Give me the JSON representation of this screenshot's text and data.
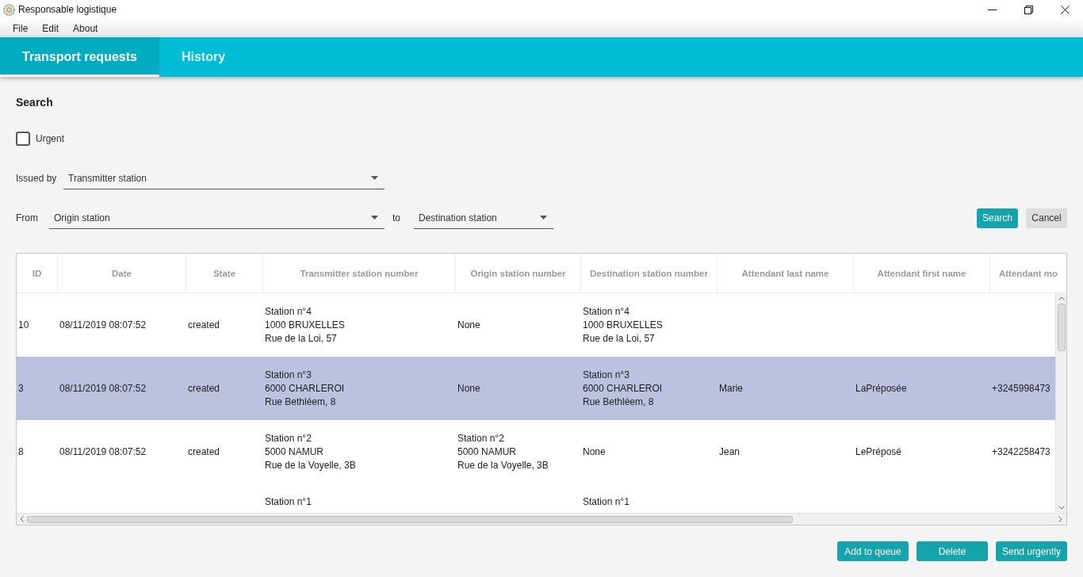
{
  "window": {
    "title": "Responsable logistique"
  },
  "menu": [
    {
      "label": "File"
    },
    {
      "label": "Edit"
    },
    {
      "label": "About"
    }
  ],
  "tabs": [
    {
      "label": "Transport requests",
      "selected": true
    },
    {
      "label": "History",
      "selected": false
    }
  ],
  "search": {
    "title": "Search",
    "urgent": {
      "label": "Urgent",
      "checked": false
    },
    "issued_by": {
      "label": "Issued by",
      "placeholder": "Transmitter station"
    },
    "from": {
      "label": "From",
      "placeholder": "Origin station"
    },
    "to": {
      "label": "to",
      "placeholder": "Destination station"
    },
    "buttons": [
      {
        "label": "Search",
        "kind": "primary"
      },
      {
        "label": "Cancel",
        "kind": "secondary"
      }
    ]
  },
  "table": {
    "columns": [
      "ID",
      "Date",
      "State",
      "Transmitter station number",
      "Origin station number",
      "Destination station number",
      "Attendant last name",
      "Attendant first name",
      "Attendant mo"
    ],
    "rows": [
      {
        "selected": false,
        "cells": [
          "10",
          "08/11/2019 08:07:52",
          "created",
          "Station n°4\n1000 BRUXELLES\nRue de la Loi, 57",
          "None",
          "Station n°4\n1000 BRUXELLES\nRue de la Loi, 57",
          null,
          null,
          null
        ]
      },
      {
        "selected": true,
        "cells": [
          "3",
          "08/11/2019 08:07:52",
          "created",
          "Station n°3\n6000 CHARLEROI\nRue Bethléem, 8",
          "None",
          "Station n°3\n6000 CHARLEROI\nRue Bethléem, 8",
          "Marie",
          "LaPréposée",
          "+3245998473"
        ]
      },
      {
        "selected": false,
        "cells": [
          "8",
          "08/11/2019 08:07:52",
          "created",
          "Station n°2\n5000 NAMUR\nRue de la Voyelle, 3B",
          "Station n°2\n5000 NAMUR\nRue de la Voyelle, 3B",
          "None",
          "Jean",
          "LePréposé",
          "+3242258473"
        ]
      },
      {
        "selected": false,
        "cut_off": true,
        "cells": [
          null,
          null,
          null,
          "Station n°1",
          null,
          "Station n°1",
          null,
          null,
          null
        ]
      }
    ]
  },
  "actions": [
    {
      "label": "Add to queue"
    },
    {
      "label": "Delete"
    },
    {
      "label": "Send urgently"
    }
  ]
}
